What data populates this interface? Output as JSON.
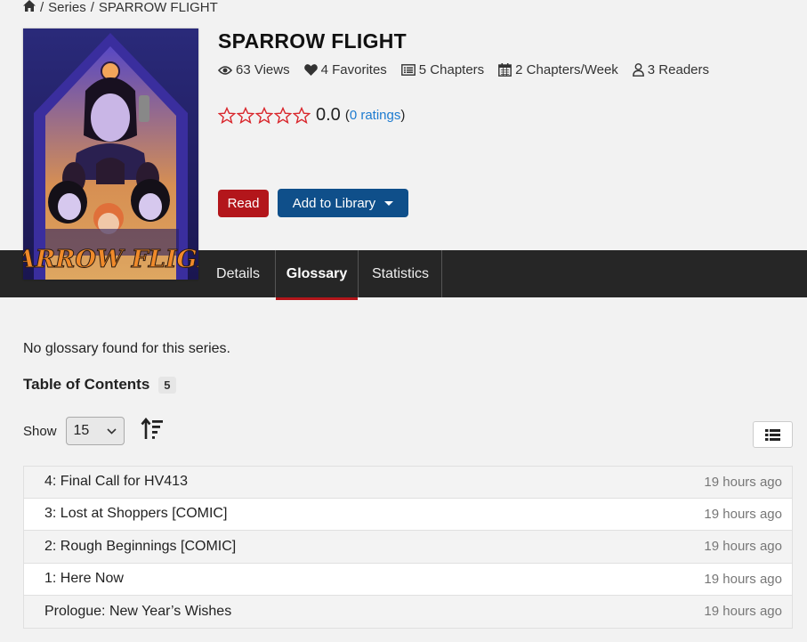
{
  "breadcrumb": {
    "sep1": "/",
    "series": "Series",
    "sep2": "/",
    "current": "SPARROW FLIGHT"
  },
  "cover": {
    "art_text": "SPARROW FLIGHT"
  },
  "title": "SPARROW FLIGHT",
  "stats": {
    "views": "63 Views",
    "favorites": "4 Favorites",
    "chapters": "5 Chapters",
    "per_week": "2 Chapters/Week",
    "readers": "3 Readers"
  },
  "rating": {
    "stars_filled": 0,
    "stars_total": 5,
    "value": "0.0",
    "open_paren": "(",
    "count_label": "0 ratings",
    "close_paren": ")"
  },
  "buttons": {
    "read": "Read",
    "add_to_library": "Add to Library"
  },
  "tabs": [
    {
      "label": "Details"
    },
    {
      "label": "Glossary"
    },
    {
      "label": "Statistics"
    }
  ],
  "glossary": {
    "empty_message": "No glossary found for this series."
  },
  "toc": {
    "title": "Table of Contents",
    "count": "5",
    "show_label": "Show",
    "show_value": "15",
    "chapters": [
      {
        "title": "4: Final Call for HV413",
        "time": "19 hours ago"
      },
      {
        "title": "3: Lost at Shoppers [COMIC]",
        "time": "19 hours ago"
      },
      {
        "title": "2: Rough Beginnings [COMIC]",
        "time": "19 hours ago"
      },
      {
        "title": "1: Here Now",
        "time": "19 hours ago"
      },
      {
        "title": "Prologue: New Year’s Wishes",
        "time": "19 hours ago"
      }
    ]
  },
  "colors": {
    "accent_red": "#b3161b",
    "library_blue": "#0f4f8a",
    "link_blue": "#1d7bd0",
    "tabbar_bg": "#262626",
    "star_outline": "#d9262c"
  },
  "icons": {
    "home": "home-icon",
    "views": "eye-icon",
    "favorites": "heart-icon",
    "chapters": "list-icon",
    "per_week": "calendar-icon",
    "readers": "user-icon",
    "sort": "sort-icon",
    "list_toggle": "list-view-icon"
  }
}
